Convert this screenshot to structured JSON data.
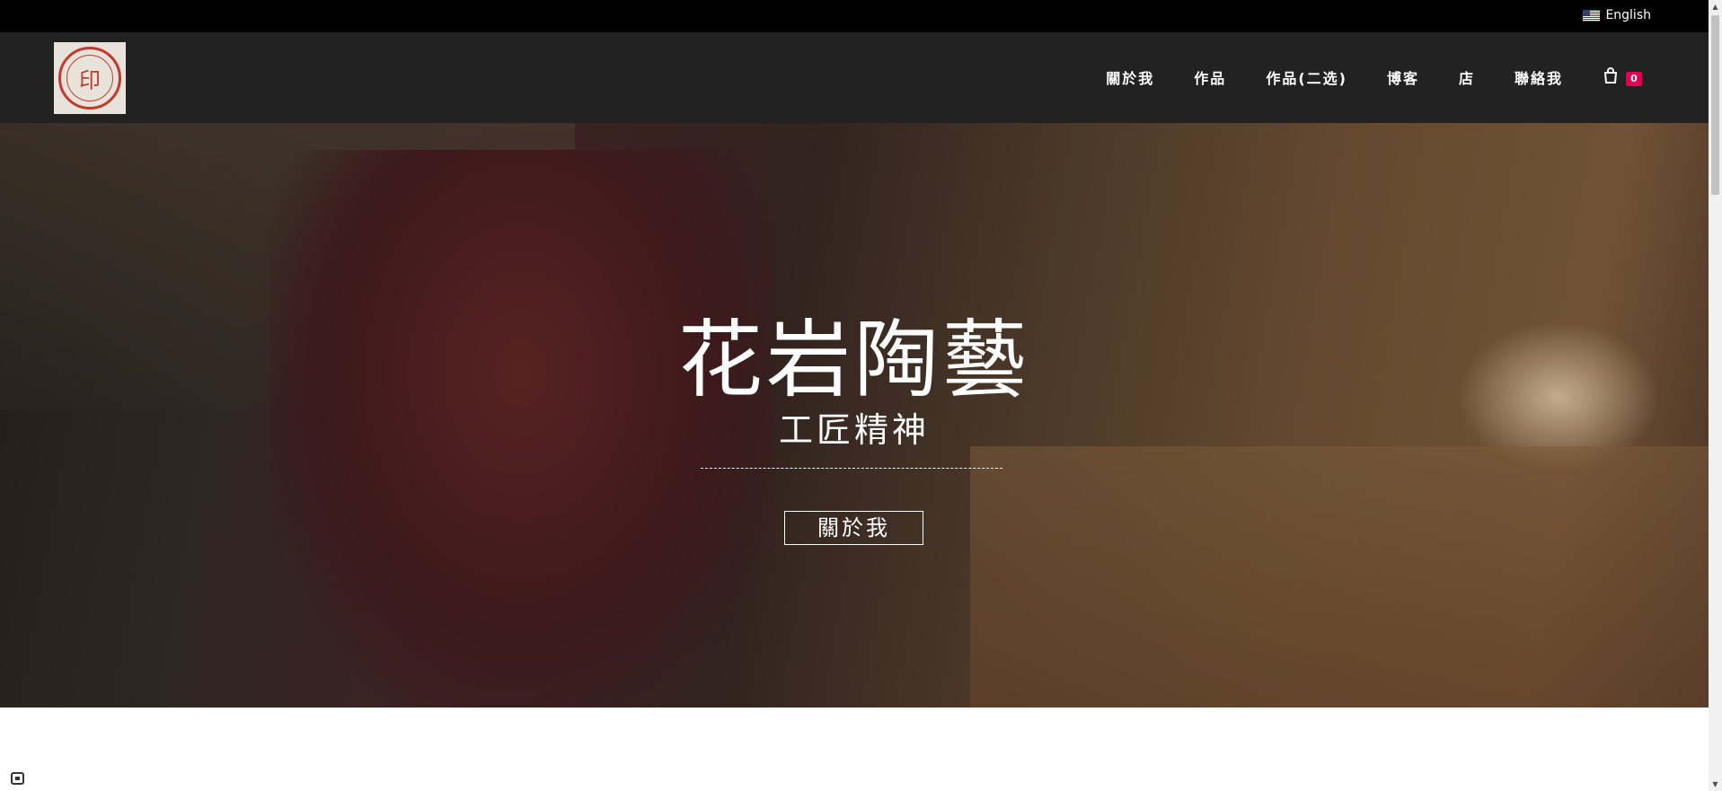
{
  "topbar": {
    "language_label": "English"
  },
  "header": {
    "nav": [
      {
        "label": "關於我"
      },
      {
        "label": "作品"
      },
      {
        "label": "作品(二选)"
      },
      {
        "label": "博客"
      },
      {
        "label": "店"
      },
      {
        "label": "聯絡我"
      }
    ],
    "cart_count": "0",
    "logo_glyph": "印"
  },
  "hero": {
    "title": "花岩陶藝",
    "subtitle": "工匠精神",
    "button_label": "關於我"
  },
  "colors": {
    "topbar_bg": "#000000",
    "header_bg": "#222222",
    "cart_badge": "#e5004f",
    "seal_red": "#c23a2b"
  }
}
